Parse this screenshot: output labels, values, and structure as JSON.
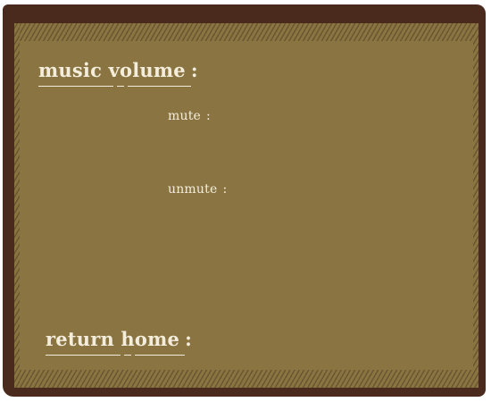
{
  "settings": {
    "music_volume_label": "music volume",
    "mute_label": "mute",
    "unmute_label": "unmute",
    "return_home_label": "return home",
    "separator": ":"
  },
  "colors": {
    "frame": "#4a2a1c",
    "panel": "#8a7542",
    "hatch": "#6a5630",
    "text": "#f4eddc"
  }
}
